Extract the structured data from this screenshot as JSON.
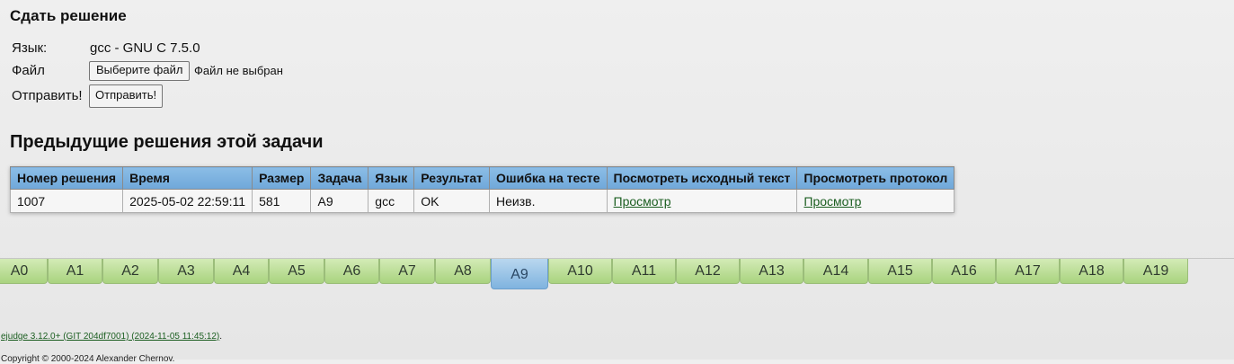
{
  "submit": {
    "heading": "Сдать решение",
    "language_label": "Язык:",
    "language_value": "gcc - GNU C 7.5.0",
    "file_label": "Файл",
    "file_button": "Выберите файл",
    "file_status": "Файл не выбран",
    "send_label": "Отправить!",
    "send_button": "Отправить!"
  },
  "previous": {
    "heading": "Предыдущие решения этой задачи",
    "columns": [
      "Номер решения",
      "Время",
      "Размер",
      "Задача",
      "Язык",
      "Результат",
      "Ошибка на тесте",
      "Посмотреть исходный текст",
      "Просмотреть протокол"
    ],
    "rows": [
      [
        "1007",
        "2025-05-02 22:59:11",
        "581",
        "A9",
        "gcc",
        "OK",
        "Неизв.",
        "Просмотр",
        "Просмотр"
      ]
    ]
  },
  "tabs": {
    "items": [
      "A0",
      "A1",
      "A2",
      "A3",
      "A4",
      "A5",
      "A6",
      "A7",
      "A8",
      "A9",
      "A10",
      "A11",
      "A12",
      "A13",
      "A14",
      "A15",
      "A16",
      "A17",
      "A18",
      "A19"
    ],
    "active": "A9"
  },
  "footer": {
    "version_link": "ejudge 3.12.0+ (GIT 204df7001) (2024-11-05 11:45:12)",
    "version_suffix": ".",
    "copyright": "Copyright © 2000-2024 Alexander Chernov."
  }
}
